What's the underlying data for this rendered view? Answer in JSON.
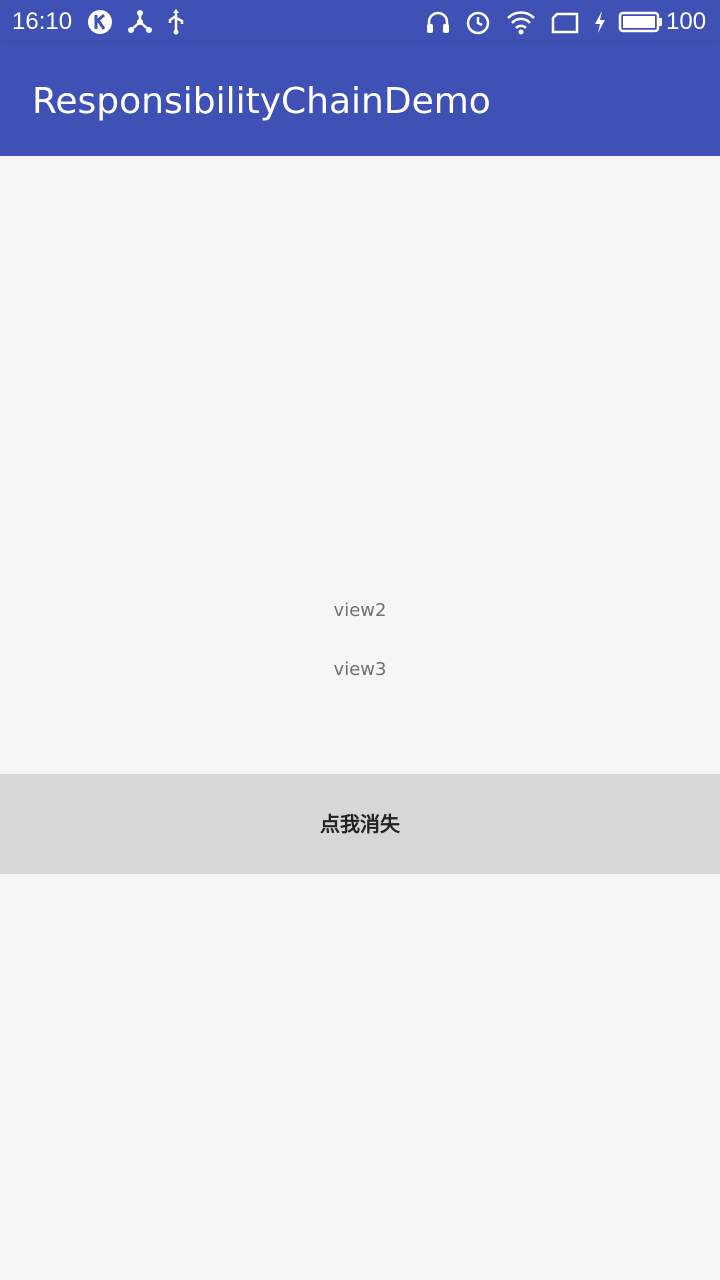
{
  "status_bar": {
    "time": "16:10",
    "battery_level": "100",
    "left_icons": [
      "k-app-icon",
      "share-network-icon",
      "usb-icon"
    ],
    "right_icons": [
      "headphones-icon",
      "alarm-icon",
      "wifi-icon",
      "sim-icon",
      "charging-bolt-icon",
      "battery-icon"
    ]
  },
  "app_bar": {
    "title": "ResponsibilityChainDemo",
    "color": "#3f51b5"
  },
  "content": {
    "view2_label": "view2",
    "view3_label": "view3",
    "dismiss_button_label": "点我消失"
  }
}
